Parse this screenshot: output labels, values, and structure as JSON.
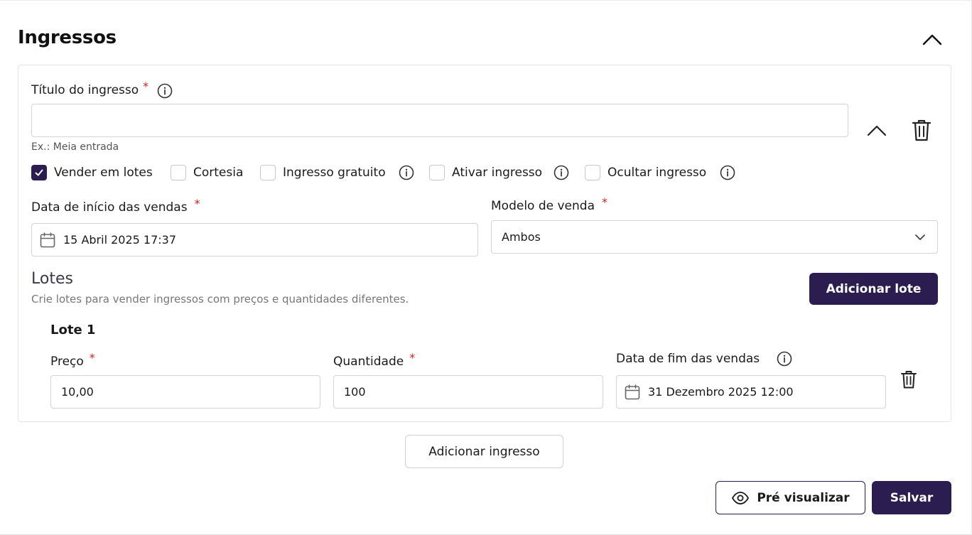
{
  "section": {
    "title": "Ingressos",
    "collapse_icon": "chevron-up-icon"
  },
  "ticket": {
    "title_label": "Título do ingresso",
    "required_mark": "*",
    "title_value": "",
    "title_hint": "Ex.: Meia entrada",
    "collapse_icon": "chevron-up-icon",
    "delete_icon": "trash-icon",
    "options": [
      {
        "label": "Vender em lotes",
        "checked": true,
        "info": false
      },
      {
        "label": "Cortesia",
        "checked": false,
        "info": false
      },
      {
        "label": "Ingresso gratuito",
        "checked": false,
        "info": true
      },
      {
        "label": "Ativar ingresso",
        "checked": false,
        "info": true
      },
      {
        "label": "Ocultar ingresso",
        "checked": false,
        "info": true
      }
    ],
    "start_date_label": "Data de início das vendas",
    "start_date_value": "15 Abril 2025 17:37",
    "sale_model_label": "Modelo de venda",
    "sale_model_value": "Ambos"
  },
  "lotes": {
    "title": "Lotes",
    "description": "Crie lotes para vender ingressos com preços e quantidades diferentes.",
    "add_button": "Adicionar lote",
    "items": [
      {
        "name": "Lote 1",
        "price_label": "Preço",
        "price_value": "10,00",
        "quantity_label": "Quantidade",
        "quantity_value": "100",
        "end_date_label": "Data de fim das vendas",
        "end_date_value": "31 Dezembro 2025 12:00"
      }
    ]
  },
  "actions": {
    "add_ticket": "Adicionar ingresso",
    "preview": "Pré visualizar",
    "save": "Salvar"
  },
  "colors": {
    "primary": "#2b1d4f",
    "required": "#d32020",
    "border": "#d4d4d8"
  }
}
